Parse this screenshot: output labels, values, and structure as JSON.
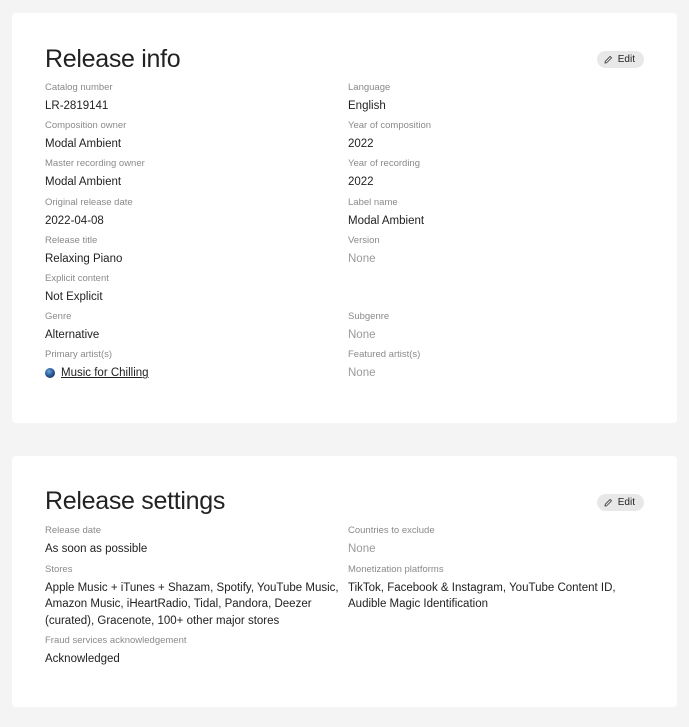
{
  "release_info": {
    "title": "Release info",
    "edit_label": "Edit",
    "left": [
      {
        "label": "Catalog number",
        "value": "LR-2819141"
      },
      {
        "label": "Composition owner",
        "value": "Modal Ambient"
      },
      {
        "label": "Master recording owner",
        "value": "Modal Ambient"
      },
      {
        "label": "Original release date",
        "value": "2022-04-08"
      },
      {
        "label": "Release title",
        "value": "Relaxing Piano"
      },
      {
        "label": "Explicit content",
        "value": "Not Explicit"
      },
      {
        "label": "Genre",
        "value": "Alternative"
      },
      {
        "label": "Primary artist(s)",
        "value": "Music for Chilling"
      }
    ],
    "right": [
      {
        "label": "Language",
        "value": "English"
      },
      {
        "label": "Year of composition",
        "value": "2022"
      },
      {
        "label": "Year of recording",
        "value": "2022"
      },
      {
        "label": "Label name",
        "value": "Modal Ambient"
      },
      {
        "label": "Version",
        "value": "None"
      },
      {
        "label": "Subgenre",
        "value": "None"
      },
      {
        "label": "Featured artist(s)",
        "value": "None"
      }
    ]
  },
  "release_settings": {
    "title": "Release settings",
    "edit_label": "Edit",
    "left": [
      {
        "label": "Release date",
        "value": "As soon as possible"
      },
      {
        "label": "Stores",
        "value": "Apple Music + iTunes + Shazam, Spotify, YouTube Music, Amazon Music, iHeartRadio, Tidal, Pandora, Deezer (curated), Gracenote, 100+ other major stores"
      },
      {
        "label": "Fraud services acknowledgement",
        "value": "Acknowledged"
      }
    ],
    "right": [
      {
        "label": "Countries to exclude",
        "value": "None"
      },
      {
        "label": "Monetization platforms",
        "value": "TikTok, Facebook & Instagram, YouTube Content ID, Audible Magic Identification"
      }
    ]
  }
}
